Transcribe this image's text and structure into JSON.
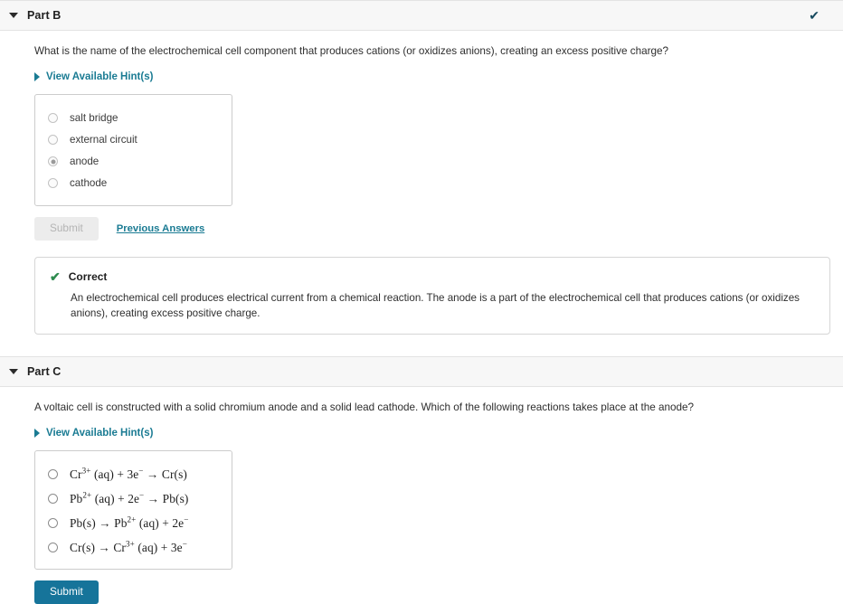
{
  "parts": [
    {
      "id": "part-b",
      "title": "Part B",
      "status_icon": "check-icon",
      "status_color": "#16495e",
      "collapse_icon": "triangle-down-icon",
      "question": "What is the name of the electrochemical cell component that produces cations (or oxidizes anions), creating an excess positive charge?",
      "hint_link": "View Available Hint(s)",
      "options": [
        {
          "label": "salt bridge",
          "selected": false
        },
        {
          "label": "external circuit",
          "selected": false
        },
        {
          "label": "anode",
          "selected": true
        },
        {
          "label": "cathode",
          "selected": false
        }
      ],
      "submit_label": "Submit",
      "submit_enabled": false,
      "previous_answers_label": "Previous Answers",
      "feedback": {
        "icon": "check-icon",
        "title": "Correct",
        "color": "#2e8b4f",
        "text": "An electrochemical cell produces electrical current from a chemical reaction. The anode is a part of the electrochemical cell that produces cations (or oxidizes anions), creating excess positive charge."
      }
    },
    {
      "id": "part-c",
      "title": "Part C",
      "collapse_icon": "triangle-down-icon",
      "question": "A voltaic cell is constructed with a solid chromium anode and a solid lead cathode. Which of the following reactions takes place at the anode?",
      "hint_link": "View Available Hint(s)",
      "options": [
        {
          "parts": [
            {
              "t": "Cr"
            },
            {
              "sup": "3+"
            },
            {
              "t": " (aq) + 3e"
            },
            {
              "sup": "−"
            },
            {
              "t": " → Cr(s)"
            }
          ],
          "selected": false
        },
        {
          "parts": [
            {
              "t": "Pb"
            },
            {
              "sup": "2+"
            },
            {
              "t": " (aq) + 2e"
            },
            {
              "sup": "−"
            },
            {
              "t": " → Pb(s)"
            }
          ],
          "selected": false
        },
        {
          "parts": [
            {
              "t": "Pb(s) → Pb"
            },
            {
              "sup": "2+"
            },
            {
              "t": " (aq) + 2e"
            },
            {
              "sup": "−"
            }
          ],
          "selected": false
        },
        {
          "parts": [
            {
              "t": "Cr(s) → Cr"
            },
            {
              "sup": "3+"
            },
            {
              "t": " (aq) + 3e"
            },
            {
              "sup": "−"
            }
          ],
          "selected": false
        }
      ],
      "submit_label": "Submit",
      "submit_enabled": true
    }
  ],
  "colors": {
    "link": "#1a7b93",
    "primary_button": "#16749a",
    "correct_green": "#2e8b4f",
    "header_bg": "#f7f7f7",
    "border": "#cccccc"
  }
}
